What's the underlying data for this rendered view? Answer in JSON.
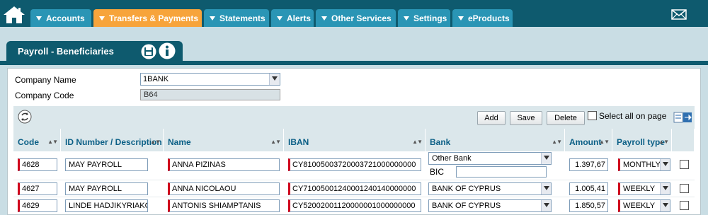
{
  "nav": {
    "tabs": [
      {
        "label": "Accounts"
      },
      {
        "label": "Transfers & Payments"
      },
      {
        "label": "Statements"
      },
      {
        "label": "Alerts"
      },
      {
        "label": "Other Services"
      },
      {
        "label": "Settings"
      },
      {
        "label": "eProducts"
      }
    ],
    "active_tab": "Transfers & Payments"
  },
  "page": {
    "title": "Payroll - Beneficiaries"
  },
  "form": {
    "company_name_label": "Company Name",
    "company_name_value": "1BANK",
    "company_code_label": "Company Code",
    "company_code_value": "B64"
  },
  "toolbar": {
    "add_label": "Add",
    "save_label": "Save",
    "delete_label": "Delete",
    "select_all_label": "Select all on page"
  },
  "table": {
    "columns": [
      {
        "label": "Code"
      },
      {
        "label": "ID Number / Description"
      },
      {
        "label": "Name"
      },
      {
        "label": "IBAN"
      },
      {
        "label": "Bank"
      },
      {
        "label": "Amount"
      },
      {
        "label": "Payroll type"
      }
    ],
    "bic_label": "BIC",
    "rows": [
      {
        "code": "4628",
        "description": "MAY PAYROLL",
        "name": "ANNA PIZINAS",
        "iban": "CY81005003720003721000000000",
        "bank": "Other Bank",
        "bic": "",
        "amount": "1.397,67",
        "payroll_type": "MONTHLY"
      },
      {
        "code": "4627",
        "description": "MAY PAYROLL",
        "name": "ANNA NICOLAOU",
        "iban": "CY71005001240001240140000000",
        "bank": "BANK OF CYPRUS",
        "amount": "1.005,41",
        "payroll_type": "WEEKLY"
      },
      {
        "code": "4629",
        "description": "LINDE HADJIKYRIAKOU",
        "name": "ANTONIS SHIAMPTANIS",
        "iban": "CY52002001120000001000000000",
        "bank": "BANK OF CYPRUS",
        "amount": "1.850,57",
        "payroll_type": "WEEKLY"
      }
    ]
  },
  "colors": {
    "nav_bg": "#0e5a6e",
    "tab_bg": "#2a95b5",
    "active_tab_bg": "#f7a43b",
    "header_text": "#0b5f86",
    "required_marker": "#d0021b"
  }
}
